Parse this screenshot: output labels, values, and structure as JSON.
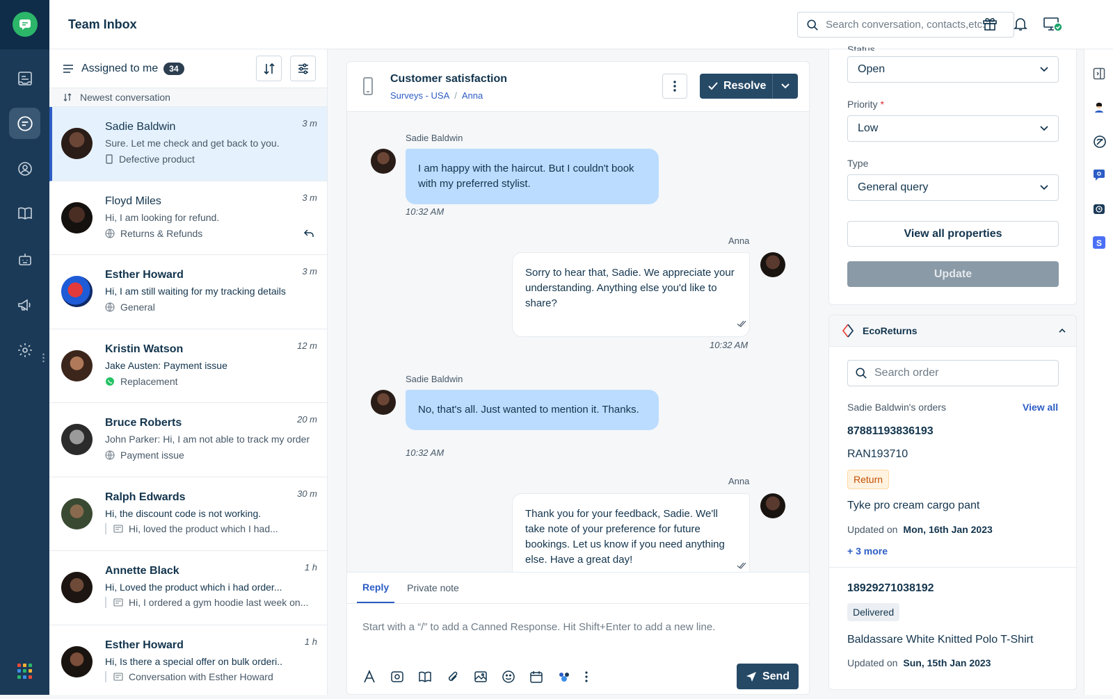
{
  "app": {
    "title": "Team Inbox"
  },
  "search": {
    "placeholder": "Search conversation, contacts,etc."
  },
  "colors": {
    "rail": "#1b3a57",
    "accent": "#2c5cc5",
    "primary_button": "#264966",
    "bubble_incoming": "#bbdcfe",
    "brand_green": "#2cb66a"
  },
  "rail": {
    "icons": [
      "logo-icon",
      "tickets-icon",
      "inbox-icon",
      "contacts-icon",
      "knowledge-base-icon",
      "bot-icon",
      "campaigns-icon",
      "settings-icon",
      "apps-grid-icon"
    ]
  },
  "list": {
    "filter_label": "Assigned to me",
    "count": "34",
    "sort_label": "Newest conversation",
    "conversations": [
      {
        "name": "Sadie Baldwin",
        "time": "3 m",
        "message": "Sure. Let me check and get back to you.",
        "tag": "Defective product",
        "tag_icon": "mobile-icon",
        "bold": false,
        "selected": true
      },
      {
        "name": "Floyd Miles",
        "time": "3 m",
        "message": "Hi, I am looking for refund.",
        "tag": "Returns & Refunds",
        "tag_icon": "globe-icon",
        "bold": false
      },
      {
        "name": "Esther Howard",
        "time": "3 m",
        "message": "Hi, I am still waiting for my tracking details",
        "tag": "General",
        "tag_icon": "globe-icon",
        "bold": true
      },
      {
        "name": "Kristin Watson",
        "time": "12 m",
        "message": "Jake Austen: Payment issue",
        "tag": "Replacement",
        "tag_icon": "whatsapp-icon",
        "bold": true
      },
      {
        "name": "Bruce Roberts",
        "time": "20 m",
        "message": "John Parker: Hi, I am not able to track my order",
        "tag": "Payment issue",
        "tag_icon": "globe-icon",
        "bold": true
      },
      {
        "name": "Ralph Edwards",
        "time": "30 m",
        "message": "Hi, the discount code is not working.",
        "tag": "Hi, loved the product which I had...",
        "tag_icon": "email-icon",
        "bold": true
      },
      {
        "name": "Annette Black",
        "time": "1 h",
        "message": "Hi, Loved the product which i had order...",
        "tag": "Hi, I ordered a gym hoodie last week on...",
        "tag_icon": "email-icon",
        "bold": true
      },
      {
        "name": "Esther Howard",
        "time": "1 h",
        "message": "Hi, Is there a special offer on bulk orderi..",
        "tag": "Conversation with Esther Howard",
        "tag_icon": "email-icon",
        "bold": true
      }
    ]
  },
  "chat": {
    "title": "Customer satisfaction",
    "breadcrumb": [
      "Surveys - USA",
      "Anna"
    ],
    "resolve_label": "Resolve",
    "messages": [
      {
        "sender": "Sadie Baldwin",
        "text": "I am happy with the haircut. But I couldn't book with my preferred stylist.",
        "time": "10:32 AM",
        "direction": "in"
      },
      {
        "sender": "Anna",
        "text": "Sorry to hear that, Sadie. We appreciate your understanding. Anything else you'd like to share?",
        "time": "10:32 AM",
        "direction": "out"
      },
      {
        "sender": "Sadie Baldwin",
        "text": "No, that's all. Just wanted to mention it. Thanks.",
        "time": "10:32 AM",
        "direction": "in"
      },
      {
        "sender": "Anna",
        "text": "Thank you for your feedback, Sadie. We'll take note of your preference for future bookings. Let us know if you need anything else. Have a great day!",
        "time": "",
        "direction": "out"
      }
    ],
    "composer": {
      "tabs": [
        "Reply",
        "Private note"
      ],
      "placeholder": "Start with a “/” to add a Canned Response. Hit Shift+Enter to add a new line.",
      "send_label": "Send"
    }
  },
  "properties": {
    "status_label": "Status",
    "status_value": "Open",
    "priority_label": "Priority",
    "priority_value": "Low",
    "type_label": "Type",
    "type_value": "General query",
    "view_all_label": "View all properties",
    "update_label": "Update"
  },
  "eco": {
    "title": "EcoReturns",
    "search_placeholder": "Search order",
    "orders_title": "Sadie Baldwin's orders",
    "view_all": "View all",
    "orders": [
      {
        "id": "87881193836193",
        "ran": "RAN193710",
        "status": "Return",
        "product": "Tyke pro cream cargo pant",
        "updated_label": "Updated on",
        "updated": "Mon, 16th Jan 2023",
        "more": "+ 3 more"
      },
      {
        "id": "18929271038192",
        "status": "Delivered",
        "product": "Baldassare White Knitted Polo T-Shirt",
        "updated_label": "Updated on",
        "updated": "Sun, 15th Jan 2023"
      }
    ]
  }
}
